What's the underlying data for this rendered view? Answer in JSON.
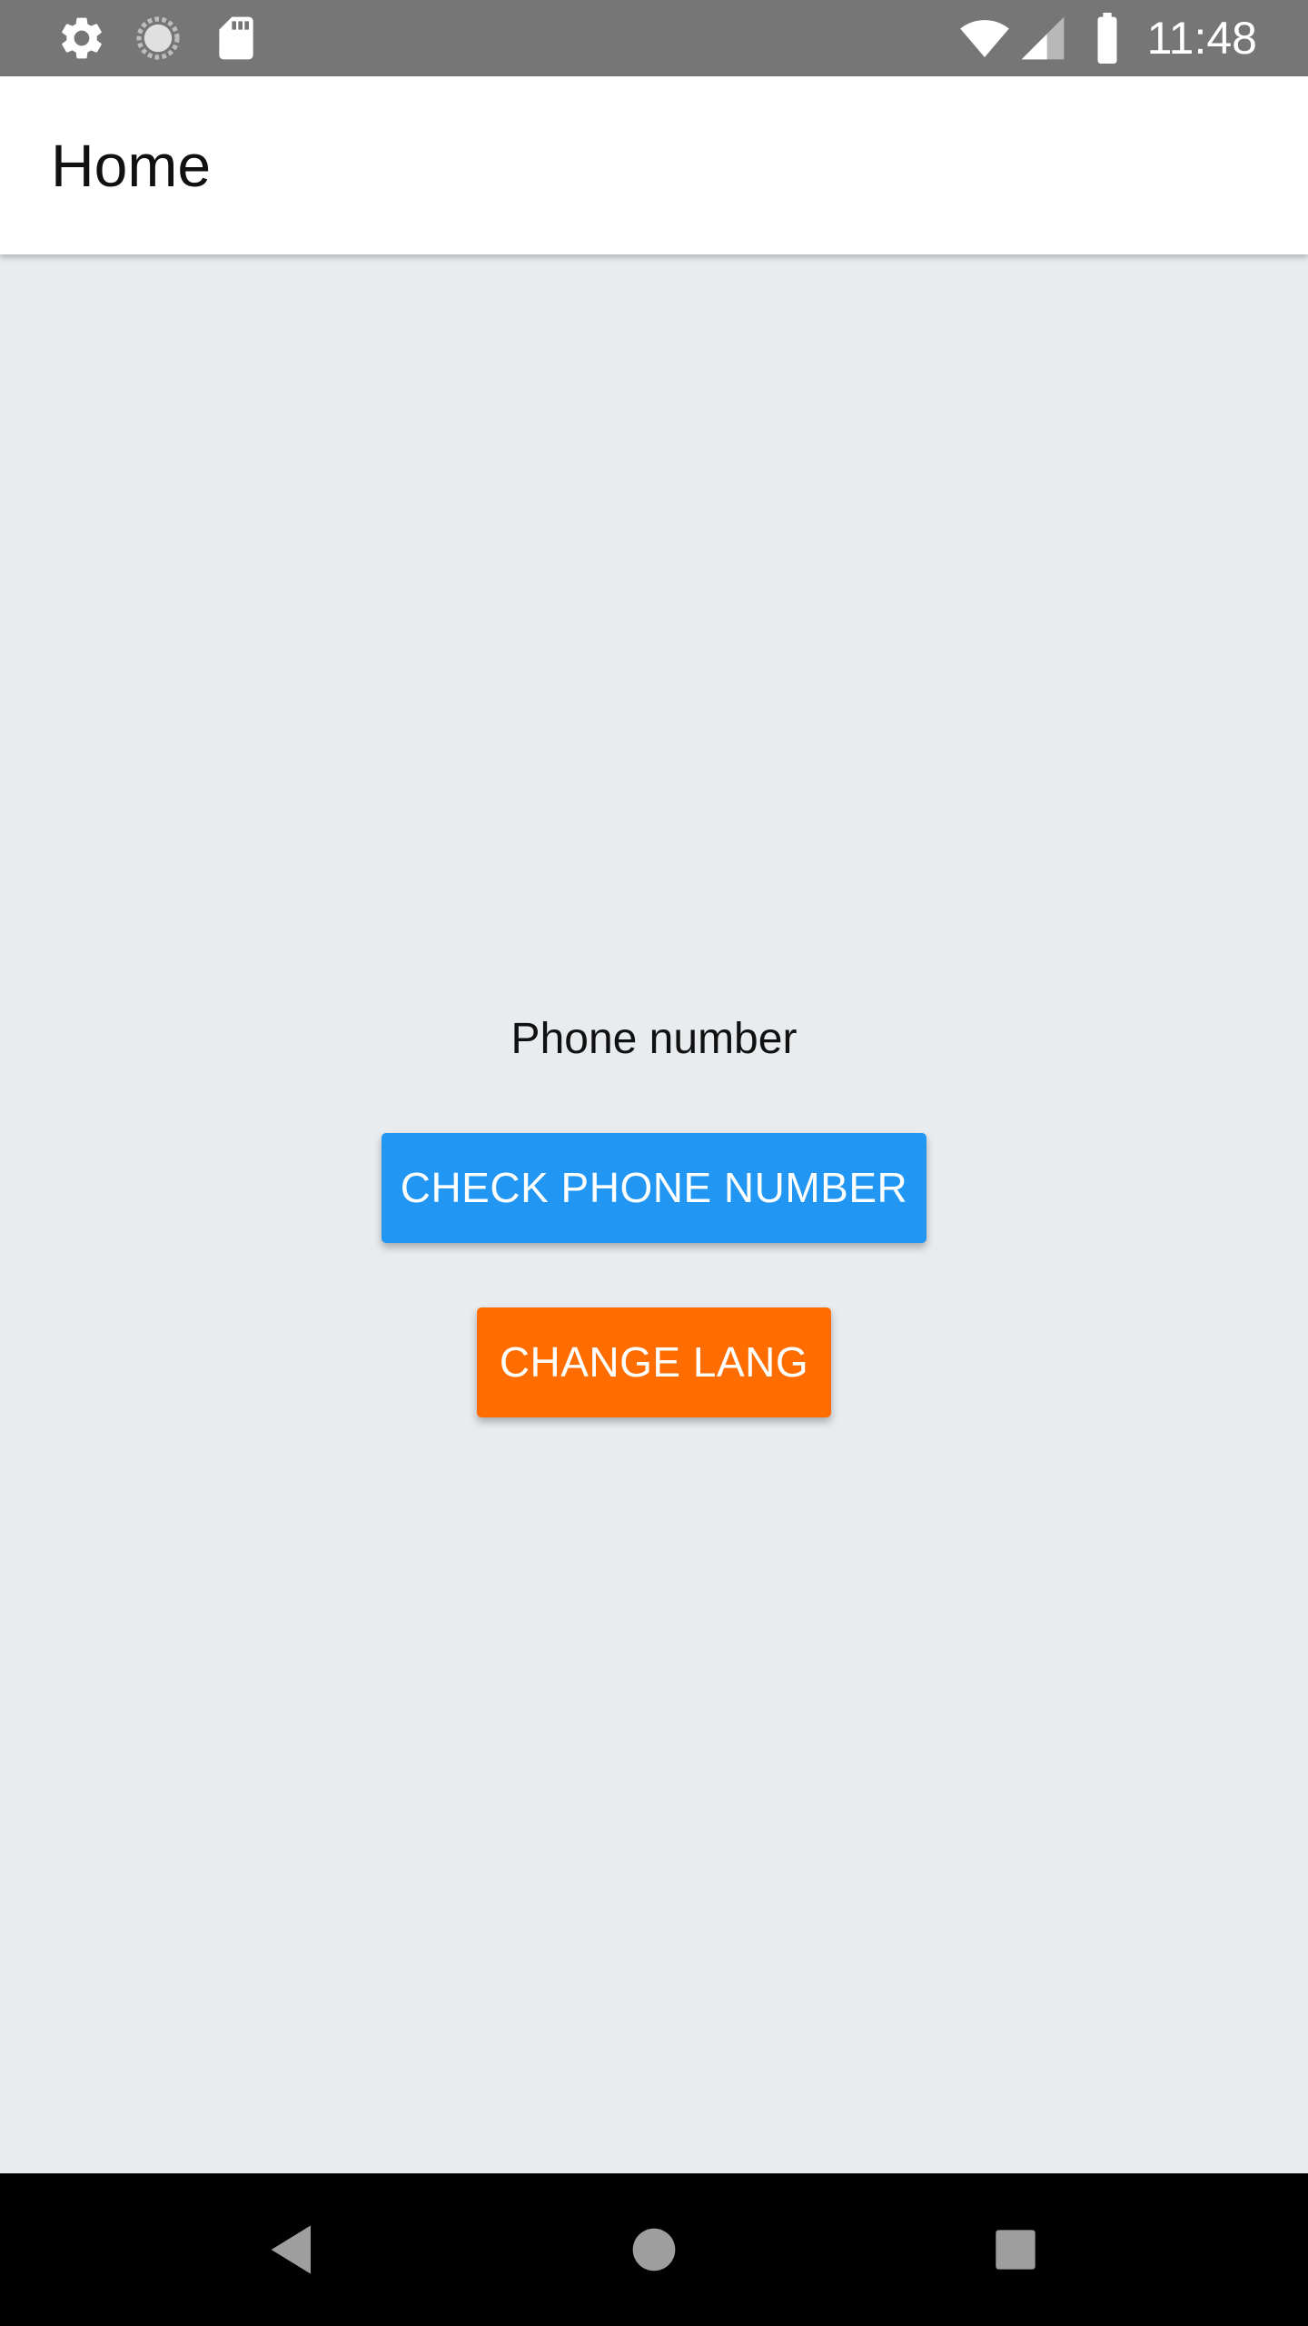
{
  "status_bar": {
    "time": "11:48",
    "icons": [
      "settings-icon",
      "loading-icon",
      "sd-card-icon",
      "wifi-icon",
      "signal-icon",
      "battery-icon"
    ]
  },
  "app_bar": {
    "title": "Home"
  },
  "main": {
    "label": "Phone number",
    "check_button": "CHECK PHONE NUMBER",
    "change_lang_button": "CHANGE LANG"
  },
  "nav_bar": {
    "icons": [
      "back-icon",
      "home-icon",
      "recents-icon"
    ]
  },
  "colors": {
    "status_bar": "#767676",
    "app_bar": "#ffffff",
    "background": "#e9ecef",
    "check_button": "#2196f3",
    "change_lang_button": "#ff6d00",
    "nav_bar": "#000000"
  }
}
